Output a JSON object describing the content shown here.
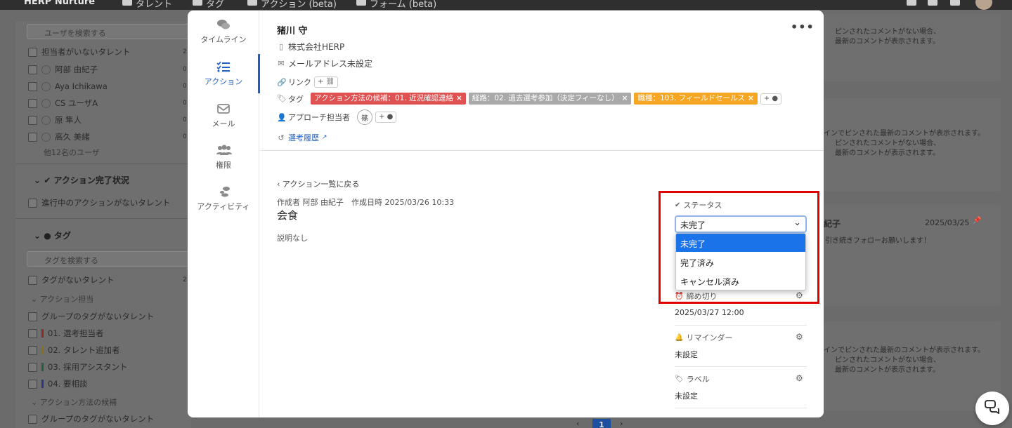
{
  "topbar": {
    "brand": "HERP Nurture",
    "nav": [
      "タレント",
      "タグ",
      "アクション (beta)",
      "フォーム (beta)"
    ]
  },
  "left_panel": {
    "search_placeholder": "ユーザを検索する",
    "users": [
      {
        "label": "担当者がいないタレント",
        "count": "2"
      },
      {
        "label": "阿部 由紀子",
        "count": "0"
      },
      {
        "label": "Aya Ichikawa",
        "count": "0"
      },
      {
        "label": "CS ユーザA",
        "count": "0"
      },
      {
        "label": "原 隼人",
        "count": "0"
      },
      {
        "label": "高久 美緒",
        "count": "0"
      }
    ],
    "more_users": "他12名のユーザ",
    "action_section_title": "アクション完了状況",
    "action_filter": "進行中のアクションがないタレント",
    "tag_section_title": "タグ",
    "tag_search_placeholder": "タグを検索する",
    "no_tag": {
      "label": "タグがないタレント",
      "count": "2"
    },
    "group_action_owner": "アクション担当",
    "group_no_tag": "グループのタグがないタレント",
    "tag_items": [
      {
        "label": "01. 選考担当者",
        "color": "#c0392b"
      },
      {
        "label": "02. タレント追加者",
        "color": "#d4a017"
      },
      {
        "label": "03. 採用アシスタント",
        "color": "#2e8b57"
      },
      {
        "label": "04. 要相談",
        "color": "#3b4cc0"
      }
    ],
    "group_action_method": "アクション方法の候補",
    "group_no_tag2": "グループのタグがないタレント"
  },
  "right_cards": {
    "pinned_1": "ピンされたコメントがない場合、",
    "pinned_2": "最新のコメントが表示されます。",
    "pinned_long": "インでピンされた最新のコメントが表示されます。",
    "card_name": "紀子",
    "card_date": "2025/03/25",
    "card_comment": "引き続きフォローお願いします！"
  },
  "pagination": {
    "current": "1"
  },
  "modal": {
    "sidebar": [
      {
        "label": "タイムライン",
        "icon": "comments-icon"
      },
      {
        "label": "アクション",
        "icon": "tasks-icon"
      },
      {
        "label": "メール",
        "icon": "mail-icon"
      },
      {
        "label": "権限",
        "icon": "users-icon"
      },
      {
        "label": "アクティビティ",
        "icon": "activity-icon"
      }
    ],
    "talent_name": "猪川 守",
    "company": "株式会社HERP",
    "email": "メールアドレス未設定",
    "link_label": "リンク",
    "link_add": "+",
    "tag_label": "タグ",
    "tags": [
      {
        "text": "アクション方法の候補：01. 近況確認連絡",
        "color": "#e05252"
      },
      {
        "text": "経路：02. 過去選考参加（決定フィーなし）",
        "color": "#a9a9a9"
      },
      {
        "text": "職種：103. フィールドセールス",
        "color": "#f5a623"
      }
    ],
    "tag_add": "+",
    "approach_label": "アプローチ担当者",
    "approach_avatar": "篠",
    "approach_add": "+",
    "history_link": "選考履歴",
    "back_link": "アクション一覧に戻る",
    "meta": "作成者 阿部 由紀子　作成日時 2025/03/26 10:33",
    "action_title": "会食",
    "description": "説明なし",
    "status_label": "ステータス",
    "status_value": "未完了",
    "status_options": [
      "未完了",
      "完了済み",
      "キャンセル済み"
    ],
    "deadline_label": "締め切り",
    "deadline_value": "2025/03/27 12:00",
    "reminder_label": "リマインダー",
    "reminder_value": "未設定",
    "label_label": "ラベル",
    "label_value": "未設定"
  }
}
